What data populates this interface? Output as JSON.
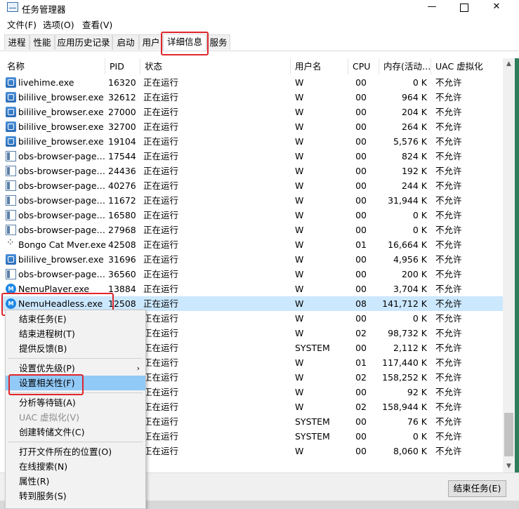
{
  "window": {
    "title": "任务管理器",
    "min_icon": "minimize-icon",
    "max_icon": "maximize-icon",
    "close_icon": "close-icon"
  },
  "menu": [
    "文件(F)",
    "选项(O)",
    "查看(V)"
  ],
  "tabs": [
    {
      "label": "进程",
      "active": false
    },
    {
      "label": "性能",
      "active": false
    },
    {
      "label": "应用历史记录",
      "active": false
    },
    {
      "label": "启动",
      "active": false
    },
    {
      "label": "用户",
      "active": false
    },
    {
      "label": "详细信息",
      "active": true
    },
    {
      "label": "服务",
      "active": false
    }
  ],
  "columns": {
    "name": "名称",
    "pid": "PID",
    "status": "状态",
    "user": "用户名",
    "cpu": "CPU",
    "mem": "内存(活动…",
    "uac": "UAC 虚拟化"
  },
  "rows": [
    {
      "icon": "blue-app-icon",
      "name": "livehime.exe",
      "pid": "16320",
      "status": "正在运行",
      "user": "W",
      "cpu": "00",
      "mem": "0 K",
      "uac": "不允许"
    },
    {
      "icon": "blue-app-icon",
      "name": "bililive_browser.exe",
      "pid": "32612",
      "status": "正在运行",
      "user": "W",
      "cpu": "00",
      "mem": "964 K",
      "uac": "不允许"
    },
    {
      "icon": "blue-app-icon",
      "name": "bililive_browser.exe",
      "pid": "27000",
      "status": "正在运行",
      "user": "W",
      "cpu": "00",
      "mem": "204 K",
      "uac": "不允许"
    },
    {
      "icon": "blue-app-icon",
      "name": "bililive_browser.exe",
      "pid": "32700",
      "status": "正在运行",
      "user": "W",
      "cpu": "00",
      "mem": "264 K",
      "uac": "不允许"
    },
    {
      "icon": "blue-app-icon",
      "name": "bililive_browser.exe",
      "pid": "19104",
      "status": "正在运行",
      "user": "W",
      "cpu": "00",
      "mem": "5,576 K",
      "uac": "不允许"
    },
    {
      "icon": "window-icon",
      "name": "obs-browser-page…",
      "pid": "17544",
      "status": "正在运行",
      "user": "W",
      "cpu": "00",
      "mem": "824 K",
      "uac": "不允许"
    },
    {
      "icon": "window-icon",
      "name": "obs-browser-page…",
      "pid": "24436",
      "status": "正在运行",
      "user": "W",
      "cpu": "00",
      "mem": "192 K",
      "uac": "不允许"
    },
    {
      "icon": "window-icon",
      "name": "obs-browser-page…",
      "pid": "40276",
      "status": "正在运行",
      "user": "W",
      "cpu": "00",
      "mem": "244 K",
      "uac": "不允许"
    },
    {
      "icon": "window-icon",
      "name": "obs-browser-page…",
      "pid": "11672",
      "status": "正在运行",
      "user": "W",
      "cpu": "00",
      "mem": "31,944 K",
      "uac": "不允许"
    },
    {
      "icon": "window-icon",
      "name": "obs-browser-page…",
      "pid": "16580",
      "status": "正在运行",
      "user": "W",
      "cpu": "00",
      "mem": "0 K",
      "uac": "不允许"
    },
    {
      "icon": "window-icon",
      "name": "obs-browser-page…",
      "pid": "27968",
      "status": "正在运行",
      "user": "W",
      "cpu": "00",
      "mem": "0 K",
      "uac": "不允许"
    },
    {
      "icon": "dots-icon",
      "name": "Bongo Cat Mver.exe",
      "pid": "42508",
      "status": "正在运行",
      "user": "W",
      "cpu": "01",
      "mem": "16,664 K",
      "uac": "不允许"
    },
    {
      "icon": "blue-app-icon",
      "name": "bililive_browser.exe",
      "pid": "31696",
      "status": "正在运行",
      "user": "W",
      "cpu": "00",
      "mem": "4,956 K",
      "uac": "不允许"
    },
    {
      "icon": "window-icon",
      "name": "obs-browser-page…",
      "pid": "36560",
      "status": "正在运行",
      "user": "W",
      "cpu": "00",
      "mem": "200 K",
      "uac": "不允许"
    },
    {
      "icon": "nemu-icon",
      "name": "NemuPlayer.exe",
      "pid": "13884",
      "status": "正在运行",
      "user": "W",
      "cpu": "00",
      "mem": "3,704 K",
      "uac": "不允许"
    },
    {
      "icon": "nemu-icon",
      "name": "NemuHeadless.exe",
      "pid": "12508",
      "status": "正在运行",
      "user": "W",
      "cpu": "08",
      "mem": "141,712 K",
      "uac": "不允许",
      "selected": true
    },
    {
      "icon": "",
      "name": "",
      "pid": "",
      "status": "正在运行",
      "user": "W",
      "cpu": "00",
      "mem": "0 K",
      "uac": "不允许"
    },
    {
      "icon": "",
      "name": "",
      "pid": "",
      "status": "正在运行",
      "user": "W",
      "cpu": "02",
      "mem": "98,732 K",
      "uac": "不允许"
    },
    {
      "icon": "",
      "name": "",
      "pid": "",
      "status": "正在运行",
      "user": "SYSTEM",
      "cpu": "00",
      "mem": "2,112 K",
      "uac": "不允许"
    },
    {
      "icon": "",
      "name": "",
      "pid": "",
      "status": "正在运行",
      "user": "W",
      "cpu": "01",
      "mem": "117,440 K",
      "uac": "不允许"
    },
    {
      "icon": "",
      "name": "",
      "pid": "",
      "status": "正在运行",
      "user": "W",
      "cpu": "02",
      "mem": "158,252 K",
      "uac": "不允许"
    },
    {
      "icon": "",
      "name": "",
      "pid": "",
      "status": "正在运行",
      "user": "W",
      "cpu": "00",
      "mem": "92 K",
      "uac": "不允许"
    },
    {
      "icon": "",
      "name": "",
      "pid": "",
      "status": "正在运行",
      "user": "W",
      "cpu": "02",
      "mem": "158,944 K",
      "uac": "不允许"
    },
    {
      "icon": "",
      "name": "",
      "pid": "",
      "status": "正在运行",
      "user": "SYSTEM",
      "cpu": "00",
      "mem": "76 K",
      "uac": "不允许"
    },
    {
      "icon": "",
      "name": "",
      "pid": "",
      "status": "正在运行",
      "user": "SYSTEM",
      "cpu": "00",
      "mem": "0 K",
      "uac": "不允许"
    },
    {
      "icon": "",
      "name": "",
      "pid": "",
      "status": "正在运行",
      "user": "W",
      "cpu": "00",
      "mem": "8,060 K",
      "uac": "不允许"
    }
  ],
  "context_menu": [
    {
      "label": "结束任务(E)"
    },
    {
      "label": "结束进程树(T)"
    },
    {
      "label": "提供反馈(B)"
    },
    {
      "separator": true
    },
    {
      "label": "设置优先级(P)",
      "submenu": true
    },
    {
      "label": "设置相关性(F)",
      "hover": true
    },
    {
      "separator": true
    },
    {
      "label": "分析等待链(A)"
    },
    {
      "label": "UAC 虚拟化(V)",
      "disabled": true
    },
    {
      "label": "创建转储文件(C)"
    },
    {
      "separator": true
    },
    {
      "label": "打开文件所在的位置(O)"
    },
    {
      "label": "在线搜索(N)"
    },
    {
      "label": "属性(R)"
    },
    {
      "label": "转到服务(S)"
    }
  ],
  "footer": {
    "end_task": "结束任务(E)"
  },
  "highlight_color": "#e0262b",
  "selection_color": "#cce8ff",
  "hover_color": "#91c9f7"
}
